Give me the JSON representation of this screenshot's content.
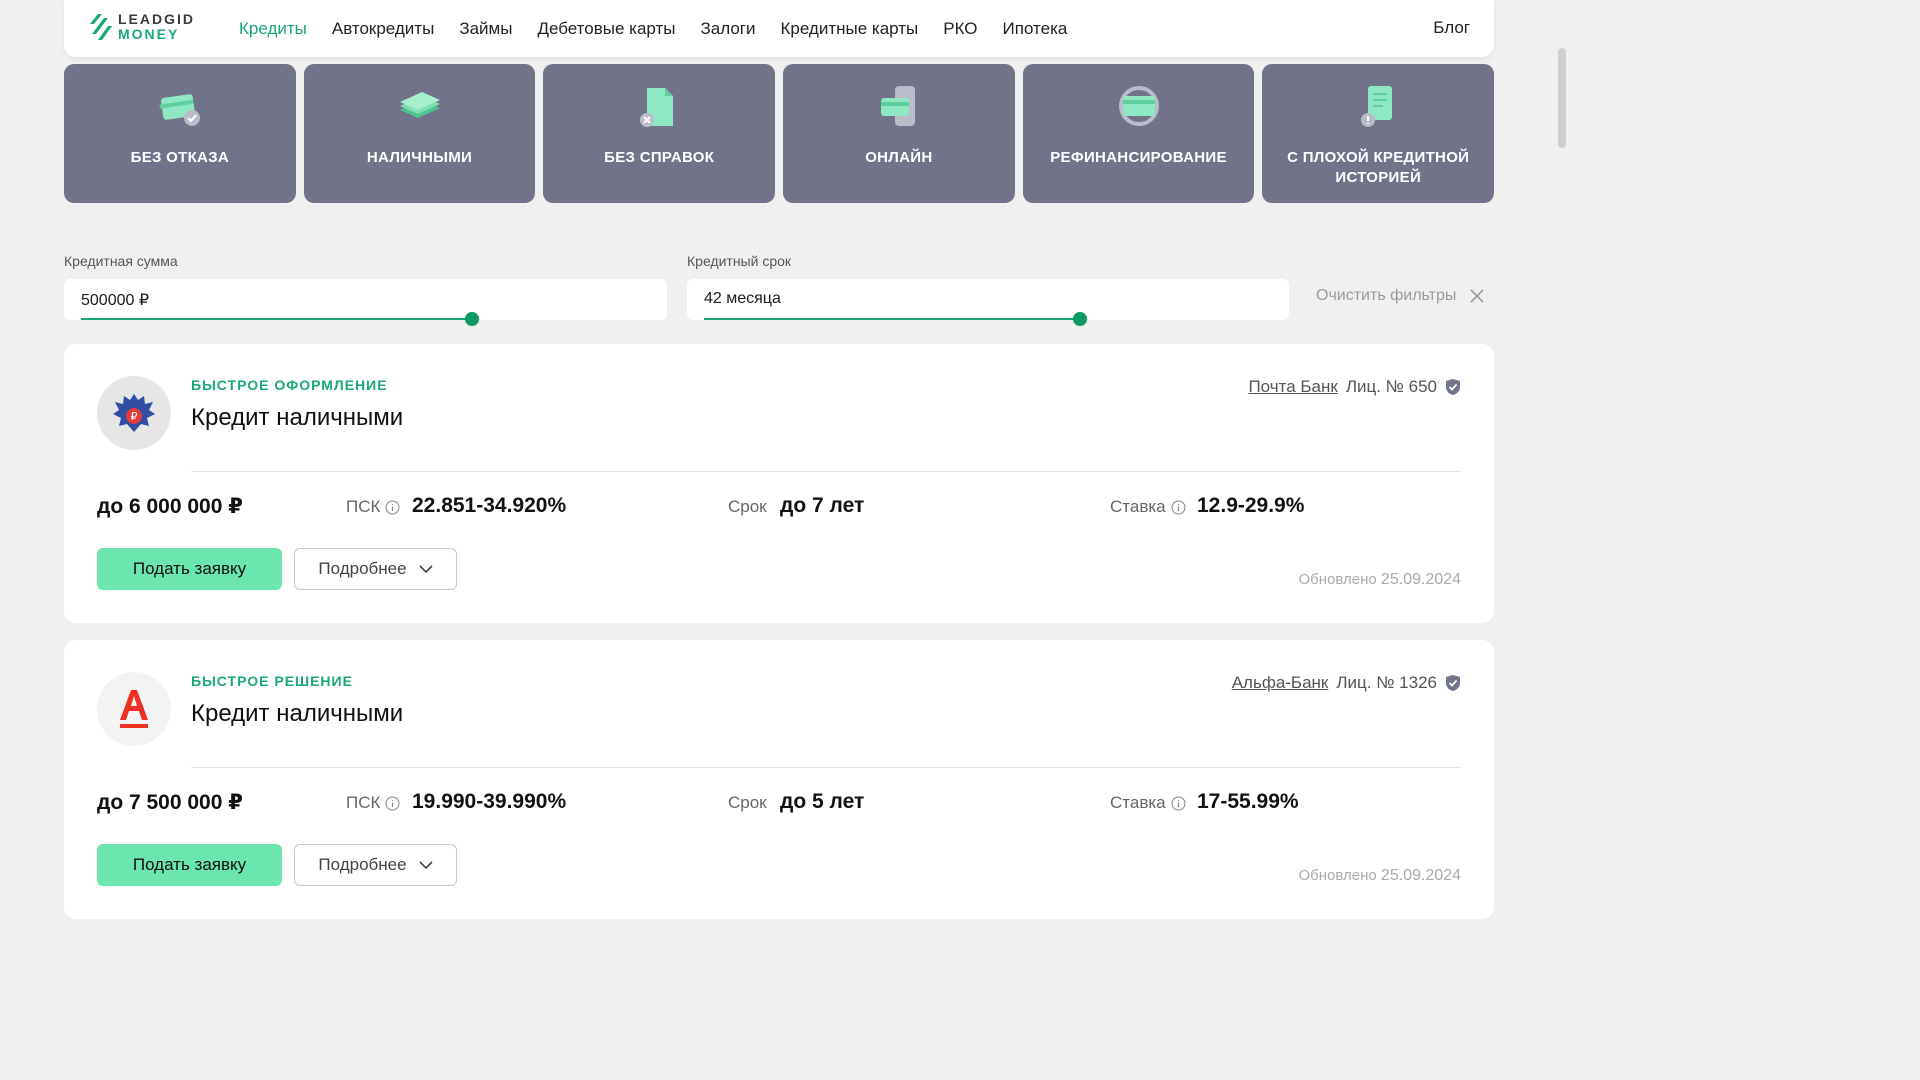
{
  "header": {
    "logo_line1": "LEADGID",
    "logo_line2": "MONEY",
    "nav": [
      "Кредиты",
      "Автокредиты",
      "Займы",
      "Дебетовые карты",
      "Залоги",
      "Кредитные карты",
      "РКО",
      "Ипотека"
    ],
    "blog": "Блог"
  },
  "categories": [
    {
      "label": "БЕЗ ОТКАЗА",
      "icon": "card-check-icon"
    },
    {
      "label": "НАЛИЧНЫМИ",
      "icon": "cash-stack-icon"
    },
    {
      "label": "БЕЗ СПРАВОК",
      "icon": "document-x-icon"
    },
    {
      "label": "ОНЛАЙН",
      "icon": "phone-card-icon"
    },
    {
      "label": "РЕФИНАНСИРОВАНИЕ",
      "icon": "card-refresh-icon"
    },
    {
      "label": "С ПЛОХОЙ КРЕДИТНОЙ ИСТОРИЕЙ",
      "icon": "document-warning-icon"
    }
  ],
  "filters": {
    "amount_label": "Кредитная сумма",
    "amount_value": "500000 ₽",
    "term_label": "Кредитный срок",
    "term_value": "42 месяца",
    "clear_label": "Очистить фильтры"
  },
  "offers": [
    {
      "badge": "БЫСТРОЕ ОФОРМЛЕНИЕ",
      "title": "Кредит наличными",
      "bank": "Почта Банк",
      "license": "Лиц. № 650",
      "amount": "до 6 000 000 ₽",
      "psk_label": "ПСК",
      "psk": "22.851-34.920%",
      "term_label": "Срок",
      "term": "до 7 лет",
      "rate_label": "Ставка",
      "rate": "12.9-29.9%",
      "apply": "Подать заявку",
      "more": "Подробнее",
      "updated_label": "Обновлено",
      "updated": "25.09.2024"
    },
    {
      "badge": "БЫСТРОЕ РЕШЕНИЕ",
      "title": "Кредит наличными",
      "bank": "Альфа-Банк",
      "license": "Лиц. № 1326",
      "amount": "до 7 500 000 ₽",
      "psk_label": "ПСК",
      "psk": "19.990-39.990%",
      "term_label": "Срок",
      "term": "до 5 лет",
      "rate_label": "Ставка",
      "rate": "17-55.99%",
      "apply": "Подать заявку",
      "more": "Подробнее",
      "updated_label": "Обновлено",
      "updated": "25.09.2024"
    }
  ]
}
